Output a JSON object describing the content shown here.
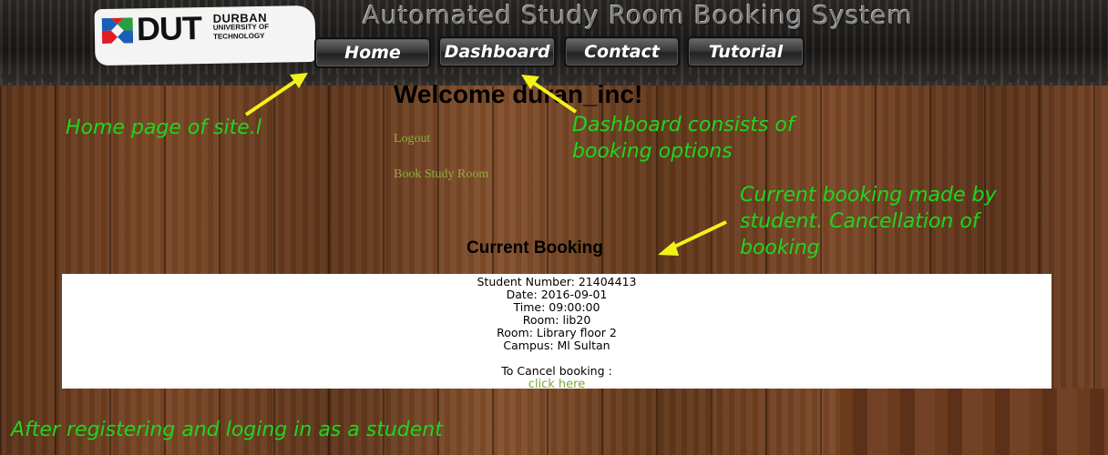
{
  "logo": {
    "brand": "DUT",
    "name_line1": "DURBAN",
    "name_line2": "UNIVERSITY OF",
    "name_line3": "TECHNOLOGY"
  },
  "site_title": "Automated Study Room Booking System",
  "nav": {
    "items": [
      {
        "label": "Home"
      },
      {
        "label": "Dashboard"
      },
      {
        "label": "Contact"
      },
      {
        "label": "Tutorial"
      }
    ]
  },
  "welcome": "Welcome duran_inc!",
  "links": {
    "logout": "Logout",
    "book": "Book Study Room"
  },
  "current_booking": {
    "title": "Current Booking",
    "student_number": "Student Number: 21404413",
    "date": "Date: 2016-09-01",
    "time": "Time: 09:00:00",
    "room": "Room: lib20",
    "room_location": "Room: Library floor 2",
    "campus": "Campus: Ml Sultan",
    "cancel_label": "To Cancel booking :",
    "cancel_link": "click here"
  },
  "annotations": {
    "home": "Home page of site.l",
    "dashboard_line1": "Dashboard consists of",
    "dashboard_line2": "booking options",
    "booking_line1": "Current booking made by",
    "booking_line2": "student. Cancellation of",
    "booking_line3": "booking",
    "footer": "After registering and loging in as  a student"
  },
  "colors": {
    "annotation": "#1ed61e",
    "arrow": "#f2f21a",
    "link": "#8fae3d"
  }
}
